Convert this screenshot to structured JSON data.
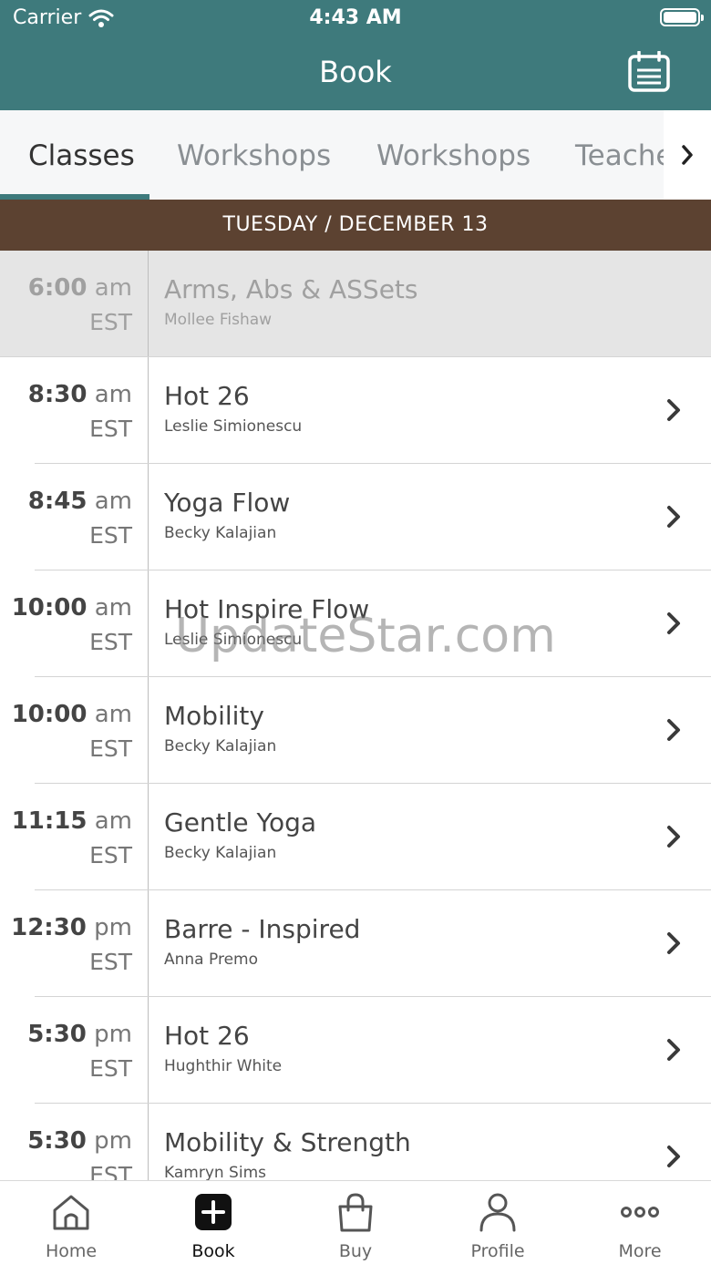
{
  "status_bar": {
    "carrier": "Carrier",
    "time": "4:43 AM"
  },
  "header": {
    "title": "Book"
  },
  "tabs": [
    {
      "label": "Classes",
      "active": true
    },
    {
      "label": "Workshops",
      "active": false
    },
    {
      "label": "Workshops",
      "active": false
    },
    {
      "label": "Teache",
      "active": false
    }
  ],
  "date_bar": {
    "label": "TUESDAY / DECEMBER 13"
  },
  "classes": [
    {
      "time": "6:00",
      "ampm": "am",
      "tz": "EST",
      "name": "Arms, Abs & ASSets",
      "teacher": "Mollee Fishaw",
      "past": true
    },
    {
      "time": "8:30",
      "ampm": "am",
      "tz": "EST",
      "name": "Hot 26",
      "teacher": "Leslie Simionescu",
      "past": false
    },
    {
      "time": "8:45",
      "ampm": "am",
      "tz": "EST",
      "name": "Yoga Flow",
      "teacher": "Becky Kalajian",
      "past": false
    },
    {
      "time": "10:00",
      "ampm": "am",
      "tz": "EST",
      "name": "Hot Inspire Flow",
      "teacher": "Leslie Simionescu",
      "past": false
    },
    {
      "time": "10:00",
      "ampm": "am",
      "tz": "EST",
      "name": "Mobility",
      "teacher": "Becky Kalajian",
      "past": false
    },
    {
      "time": "11:15",
      "ampm": "am",
      "tz": "EST",
      "name": "Gentle Yoga",
      "teacher": "Becky Kalajian",
      "past": false
    },
    {
      "time": "12:30",
      "ampm": "pm",
      "tz": "EST",
      "name": "Barre - Inspired",
      "teacher": "Anna Premo",
      "past": false
    },
    {
      "time": "5:30",
      "ampm": "pm",
      "tz": "EST",
      "name": "Hot 26",
      "teacher": "Hughthir White",
      "past": false
    },
    {
      "time": "5:30",
      "ampm": "pm",
      "tz": "EST",
      "name": "Mobility & Strength",
      "teacher": "Kamryn Sims",
      "past": false
    }
  ],
  "watermark": "UpdateStar.com",
  "bottom_nav": [
    {
      "label": "Home",
      "icon": "home-icon",
      "active": false
    },
    {
      "label": "Book",
      "icon": "plus-square-icon",
      "active": true
    },
    {
      "label": "Buy",
      "icon": "shopping-bag-icon",
      "active": false
    },
    {
      "label": "Profile",
      "icon": "person-icon",
      "active": false
    },
    {
      "label": "More",
      "icon": "more-dots-icon",
      "active": false
    }
  ],
  "colors": {
    "header": "#3e7a7c",
    "date_bar": "#5c4231",
    "tab_indicator": "#3e7a7c",
    "past_row": "#e5e5e5"
  }
}
